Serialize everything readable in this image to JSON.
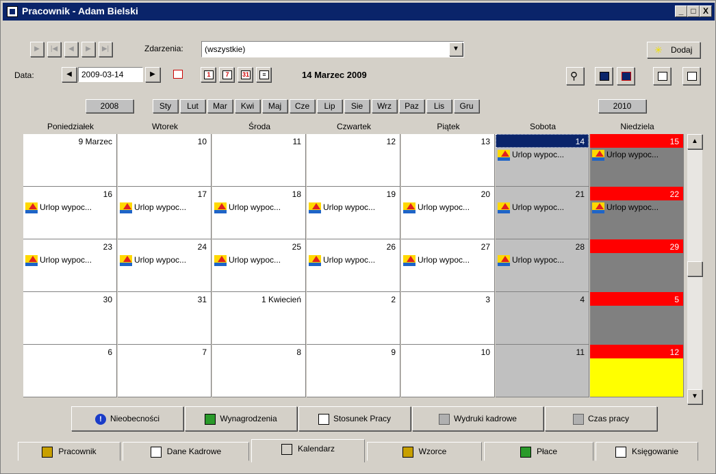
{
  "window": {
    "title": "Pracownik - Adam Bielski",
    "title_buttons": [
      "_",
      "□",
      "X"
    ]
  },
  "toolbar": {
    "nav_buttons": [
      "first-icon",
      "prev-page-icon",
      "prev-icon",
      "next-icon",
      "last-icon"
    ],
    "events_label": "Zdarzenia:",
    "events_value": "(wszystkie)",
    "add_label": "Dodaj",
    "date_label": "Data:",
    "date_value": "2009-03-14",
    "current_date_text": "14 Marzec 2009",
    "view_buttons": [
      "1",
      "7",
      "31",
      "≡"
    ]
  },
  "months": {
    "prev_year": "2008",
    "next_year": "2010",
    "items": [
      "Sty",
      "Lut",
      "Mar",
      "Kwi",
      "Maj",
      "Cze",
      "Lip",
      "Sie",
      "Wrz",
      "Paz",
      "Lis",
      "Gru"
    ]
  },
  "calendar": {
    "weekdays": [
      "Poniedziałek",
      "Wtorek",
      "Środa",
      "Czwartek",
      "Piątek",
      "Sobota",
      "Niedziela"
    ],
    "weeks": [
      [
        {
          "d": "9 Marzec"
        },
        {
          "d": "10"
        },
        {
          "d": "11"
        },
        {
          "d": "12"
        },
        {
          "d": "13"
        },
        {
          "d": "14",
          "ev": "Urlop wypoc..."
        },
        {
          "d": "15",
          "ev": "Urlop wypoc..."
        }
      ],
      [
        {
          "d": "16",
          "ev": "Urlop wypoc..."
        },
        {
          "d": "17",
          "ev": "Urlop wypoc..."
        },
        {
          "d": "18",
          "ev": "Urlop wypoc..."
        },
        {
          "d": "19",
          "ev": "Urlop wypoc..."
        },
        {
          "d": "20",
          "ev": "Urlop wypoc..."
        },
        {
          "d": "21",
          "ev": "Urlop wypoc..."
        },
        {
          "d": "22",
          "ev": "Urlop wypoc..."
        }
      ],
      [
        {
          "d": "23",
          "ev": "Urlop wypoc..."
        },
        {
          "d": "24",
          "ev": "Urlop wypoc..."
        },
        {
          "d": "25",
          "ev": "Urlop wypoc..."
        },
        {
          "d": "26",
          "ev": "Urlop wypoc..."
        },
        {
          "d": "27",
          "ev": "Urlop wypoc..."
        },
        {
          "d": "28",
          "ev": "Urlop wypoc..."
        },
        {
          "d": "29"
        }
      ],
      [
        {
          "d": "30"
        },
        {
          "d": "31"
        },
        {
          "d": "1 Kwiecień"
        },
        {
          "d": "2"
        },
        {
          "d": "3"
        },
        {
          "d": "4"
        },
        {
          "d": "5"
        }
      ],
      [
        {
          "d": "6"
        },
        {
          "d": "7"
        },
        {
          "d": "8"
        },
        {
          "d": "9"
        },
        {
          "d": "10"
        },
        {
          "d": "11"
        },
        {
          "d": "12"
        }
      ]
    ]
  },
  "bottom_buttons": [
    "Nieobecności",
    "Wynagrodzenia",
    "Stosunek Pracy",
    "Wydruki kadrowe",
    "Czas pracy"
  ],
  "tabs": [
    "Pracownik",
    "Dane Kadrowe",
    "Kalendarz",
    "Wzorce",
    "Płace",
    "Księgowanie"
  ],
  "colors": {
    "sunday": "#ff0000",
    "selected": "#0a246a",
    "highlight_day": "#ffff00",
    "weekend_bg": "#808080",
    "saturday_bg": "#c0c0c0"
  }
}
